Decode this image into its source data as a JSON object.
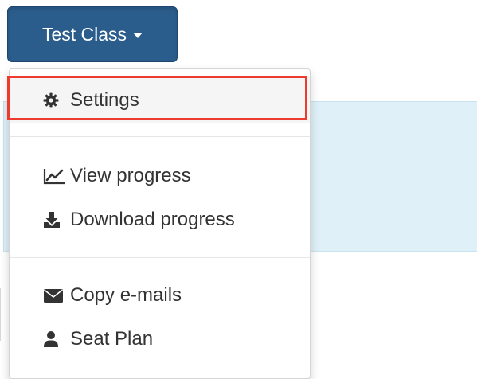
{
  "class_button": {
    "label": "Test Class"
  },
  "menu": {
    "items": [
      {
        "label": "Settings",
        "icon": "gear-icon"
      },
      {
        "label": "View progress",
        "icon": "line-chart-icon"
      },
      {
        "label": "Download progress",
        "icon": "download-icon"
      },
      {
        "label": "Copy e-mails",
        "icon": "envelope-icon"
      },
      {
        "label": "Seat Plan",
        "icon": "user-icon"
      }
    ],
    "selected": "Settings"
  },
  "colors": {
    "button_bg": "#2b5d8c",
    "highlight_border": "#ee3b30",
    "info_panel_bg": "#dff0f8"
  }
}
